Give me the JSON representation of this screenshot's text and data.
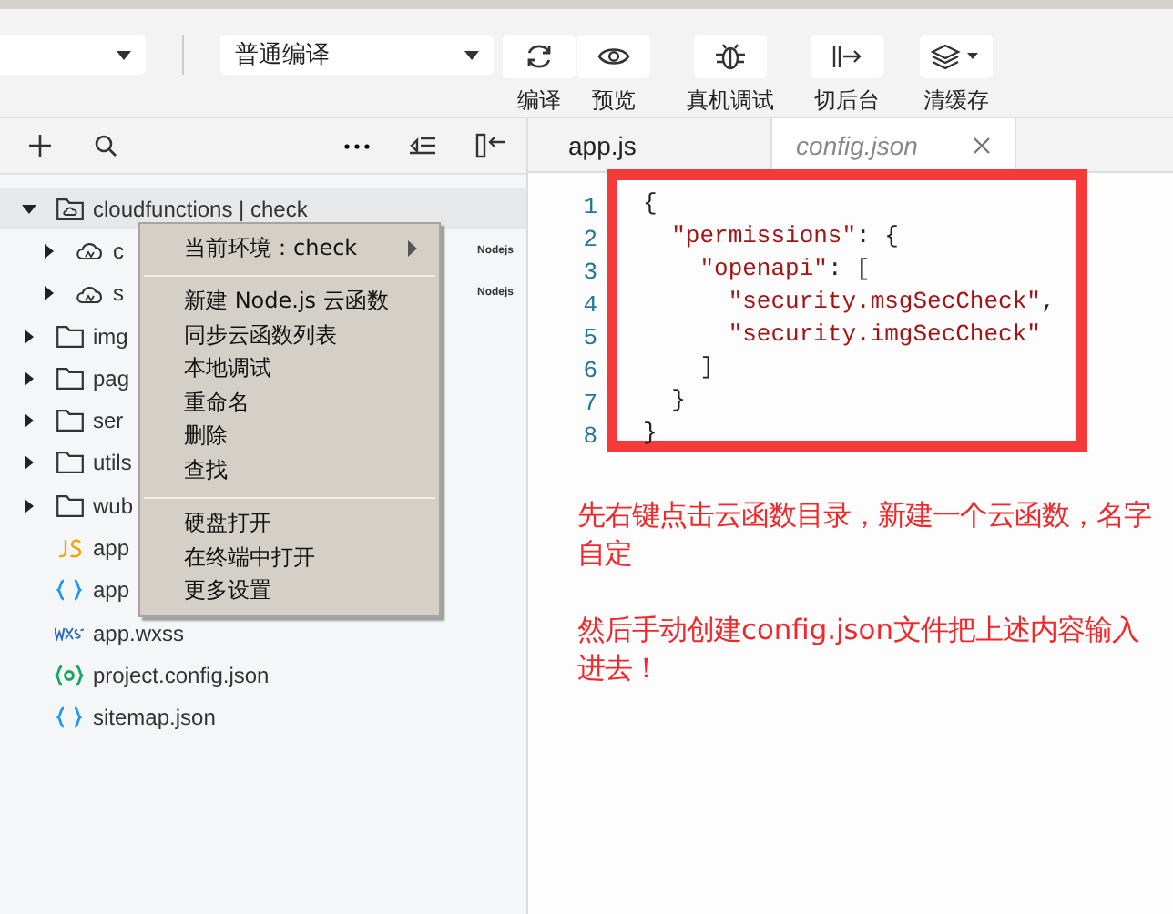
{
  "toolbar": {
    "compile_select": {
      "value": "普通编译"
    },
    "buttons": [
      {
        "kind": "refresh",
        "label": "编译"
      },
      {
        "kind": "eye",
        "label": "预览"
      },
      {
        "kind": "bug",
        "label": "真机调试"
      },
      {
        "kind": "switch",
        "label": "切后台"
      },
      {
        "kind": "layers",
        "label": "清缓存"
      }
    ]
  },
  "sidebar": {
    "tree": [
      {
        "kind": "cloud-folder",
        "label": "cloudfunctions | check",
        "expanded": true,
        "selected": true,
        "children": [
          {
            "kind": "cloud",
            "label": "c",
            "expanded": false,
            "selected": false,
            "badge": "Nodejs"
          },
          {
            "kind": "cloud",
            "label": "s",
            "expanded": false,
            "selected": false,
            "badge": "Nodejs"
          }
        ]
      },
      {
        "kind": "folder",
        "label": "img",
        "expanded": false,
        "selected": false
      },
      {
        "kind": "folder",
        "label": "pag",
        "expanded": false,
        "selected": false
      },
      {
        "kind": "folder",
        "label": "ser",
        "expanded": false,
        "selected": false
      },
      {
        "kind": "folder",
        "label": "utils",
        "expanded": false,
        "selected": false
      },
      {
        "kind": "folder",
        "label": "wub",
        "expanded": false,
        "selected": false
      },
      {
        "kind": "js",
        "label": "app",
        "selected": false
      },
      {
        "kind": "json",
        "label": "app",
        "selected": false
      },
      {
        "kind": "wxss",
        "label": "app.wxss",
        "selected": false
      },
      {
        "kind": "config",
        "label": "project.config.json",
        "selected": false
      },
      {
        "kind": "json",
        "label": "sitemap.json",
        "selected": false
      }
    ]
  },
  "context_menu": {
    "sections": [
      [
        {
          "label": "当前环境：check",
          "has_submenu": true
        }
      ],
      [
        {
          "label": "新建 Node.js 云函数",
          "has_submenu": false
        },
        {
          "label": "同步云函数列表",
          "has_submenu": false
        },
        {
          "label": "本地调试",
          "has_submenu": false
        },
        {
          "label": "重命名",
          "has_submenu": false
        },
        {
          "label": "删除",
          "has_submenu": false
        },
        {
          "label": "查找",
          "has_submenu": false
        }
      ],
      [
        {
          "label": "硬盘打开",
          "has_submenu": false
        },
        {
          "label": "在终端中打开",
          "has_submenu": false
        },
        {
          "label": "更多设置",
          "has_submenu": false
        }
      ]
    ]
  },
  "editor": {
    "tabs": [
      {
        "label": "app.js",
        "selected": false,
        "closable": false
      },
      {
        "label": "config.json",
        "selected": true,
        "closable": true
      }
    ],
    "lines": [
      {
        "number": "1",
        "text": "{"
      },
      {
        "number": "2",
        "text": "  \"permissions\": {"
      },
      {
        "number": "3",
        "text": "    \"openapi\": ["
      },
      {
        "number": "4",
        "text": "      \"security.msgSecCheck\","
      },
      {
        "number": "5",
        "text": "      \"security.imgSecCheck\""
      },
      {
        "number": "6",
        "text": "    ]"
      },
      {
        "number": "7",
        "text": "  }"
      },
      {
        "number": "8",
        "text": "}"
      }
    ],
    "annotation": [
      "先右键点击云函数目录，新建一个云函数，名字自定",
      "然后手动创建config.json文件把上述内容输入进去！"
    ]
  }
}
